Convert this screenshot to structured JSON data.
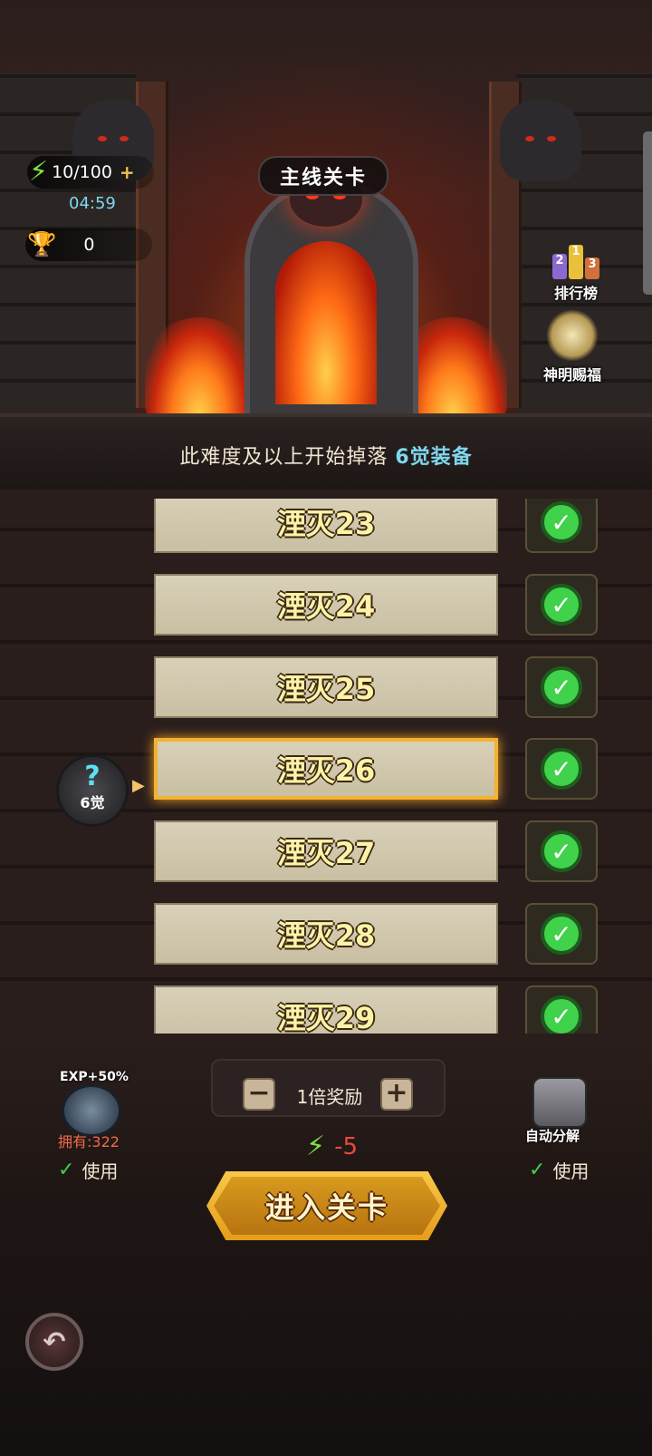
{
  "hud": {
    "stamina": "10/100",
    "stamina_plus": "+",
    "timer": "04:59",
    "trophy_count": "0"
  },
  "title": "主线关卡",
  "side_buttons": {
    "ranking": "排行榜",
    "ranking_digits": [
      "2",
      "1",
      "3"
    ],
    "blessing": "神明赐福"
  },
  "drop_notice": {
    "prefix": "此难度及以上开始掉落 ",
    "highlight": "6觉装备"
  },
  "levels": [
    {
      "name": "湮灭23",
      "cleared": true
    },
    {
      "name": "湮灭24",
      "cleared": true
    },
    {
      "name": "湮灭25",
      "cleared": true
    },
    {
      "name": "湮灭26",
      "cleared": true,
      "selected": true
    },
    {
      "name": "湮灭27",
      "cleared": true
    },
    {
      "name": "湮灭28",
      "cleared": true
    },
    {
      "name": "湮灭29",
      "cleared": true
    }
  ],
  "marker": {
    "symbol": "?",
    "label": "6觉"
  },
  "bottom": {
    "exp_tag": "EXP+50%",
    "owned": "拥有:322",
    "use_left": "使用",
    "reward_label": "1倍奖励",
    "minus": "−",
    "plus": "+",
    "cost": "-5",
    "enter": "进入关卡",
    "decompose": "自动分解",
    "use_right": "使用"
  },
  "icons": {
    "stamina": "lightning-bolt-icon",
    "trophy": "trophy-icon",
    "check": "check-icon",
    "back": "back-arrow-icon"
  }
}
